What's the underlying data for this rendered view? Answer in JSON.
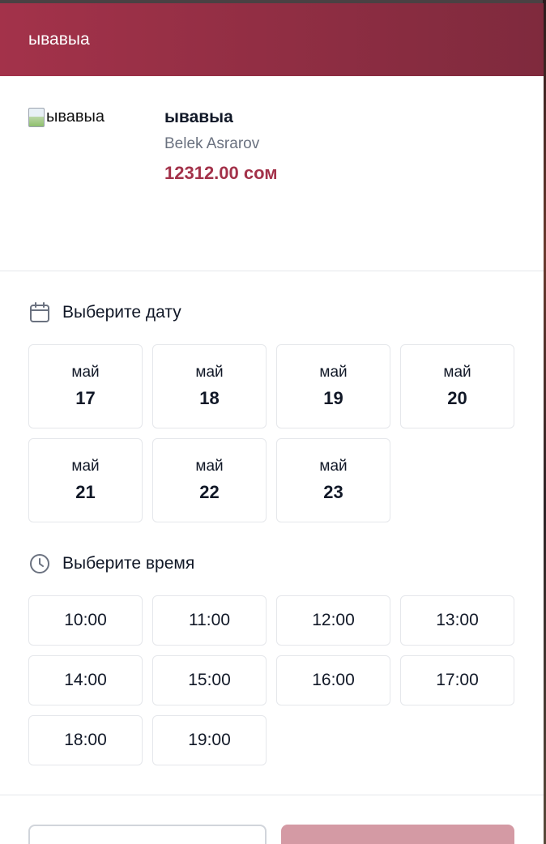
{
  "header": {
    "title": "ывавыа"
  },
  "product": {
    "image_alt": "ывавыа",
    "title": "ывавыа",
    "seller": "Belek Asrarov",
    "price": "12312.00 сом"
  },
  "date_section": {
    "heading": "Выберите дату",
    "icon": "calendar-icon",
    "dates": [
      {
        "month": "май",
        "day": "17"
      },
      {
        "month": "май",
        "day": "18"
      },
      {
        "month": "май",
        "day": "19"
      },
      {
        "month": "май",
        "day": "20"
      },
      {
        "month": "май",
        "day": "21"
      },
      {
        "month": "май",
        "day": "22"
      },
      {
        "month": "май",
        "day": "23"
      }
    ]
  },
  "time_section": {
    "heading": "Выберите время",
    "icon": "clock-icon",
    "times": [
      "10:00",
      "11:00",
      "12:00",
      "13:00",
      "14:00",
      "15:00",
      "16:00",
      "17:00",
      "18:00",
      "19:00"
    ]
  },
  "colors": {
    "accent": "#a3324a",
    "header_gradient_end": "#7f2a3d",
    "confirm_disabled": "#d49aa4"
  }
}
